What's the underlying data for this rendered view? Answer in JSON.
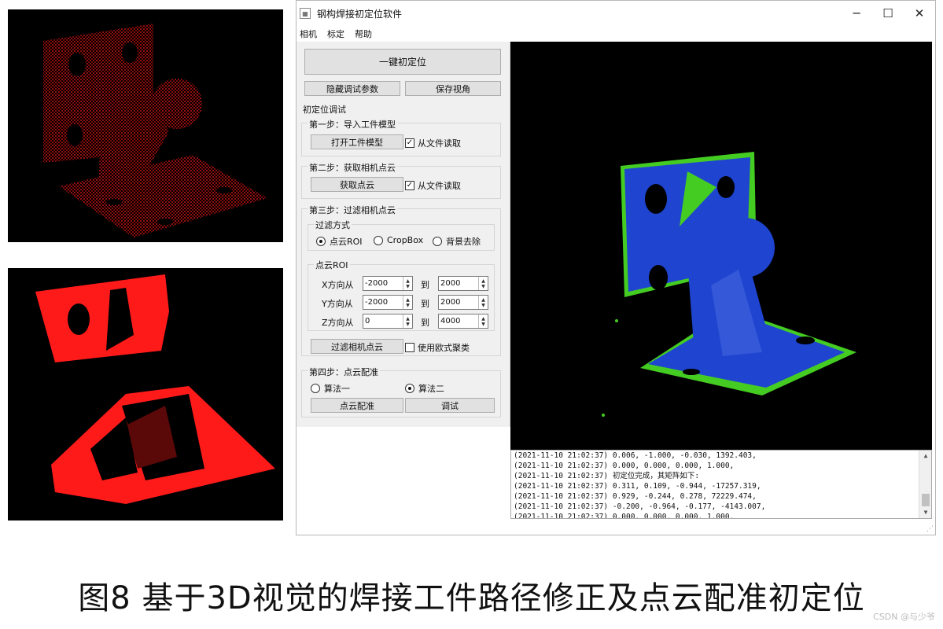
{
  "window": {
    "title": "钢构焊接初定位软件",
    "minimize_glyph": "─",
    "maximize_glyph": "☐",
    "close_glyph": "✕"
  },
  "menu": [
    "相机",
    "标定",
    "帮助"
  ],
  "buttons": {
    "one_click": "一键初定位",
    "hide_params": "隐藏调试参数",
    "save_view": "保存视角"
  },
  "debug_title": "初定位调试",
  "step1": {
    "title": "第一步：导入工件模型",
    "button": "打开工件模型",
    "checkbox": "从文件读取",
    "checked": true
  },
  "step2": {
    "title": "第二步：获取相机点云",
    "button": "获取点云",
    "checkbox": "从文件读取",
    "checked": true
  },
  "step3": {
    "title": "第三步：过滤相机点云",
    "filter_group": "过滤方式",
    "filter_options": [
      "点云ROI",
      "CropBox",
      "背景去除"
    ],
    "filter_selected": "点云ROI",
    "roi_group": "点云ROI",
    "rows": [
      {
        "label": "X方向从",
        "from": "-2000",
        "to_label": "到",
        "to": "2000"
      },
      {
        "label": "Y方向从",
        "from": "-2000",
        "to_label": "到",
        "to": "2000"
      },
      {
        "label": "Z方向从",
        "from": "0",
        "to_label": "到",
        "to": "4000"
      }
    ],
    "button": "过滤相机点云",
    "checkbox": "使用欧式聚类",
    "checked": false
  },
  "step4": {
    "title": "第四步：点云配准",
    "options": [
      "算法一",
      "算法二"
    ],
    "selected": "算法二",
    "register_button": "点云配准",
    "debug_button": "调试"
  },
  "log": [
    "(2021-11-10 21:02:37) 0.006, -1.000, -0.030, 1392.403,",
    "(2021-11-10 21:02:37) 0.000, 0.000, 0.000, 1.000,",
    "(2021-11-10 21:02:37) 初定位完成，其矩阵如下:",
    "(2021-11-10 21:02:37) 0.311, 0.109, -0.944, -17257.319,",
    "(2021-11-10 21:02:37) 0.929, -0.244, 0.278, 72229.474,",
    "(2021-11-10 21:02:37) -0.200, -0.964, -0.177, -4143.007,",
    "(2021-11-10 21:02:37) 0.000, 0.000, 0.000, 1.000,"
  ],
  "caption": "图8   基于3D视觉的焊接工件路径修正及点云配准初定位",
  "watermark": "CSDN @与少爷",
  "colors": {
    "cloud_red": "#ff1a1a",
    "model_blue": "#1e44d0",
    "scene_green": "#44cc22",
    "panel_bg": "#f0f0f0"
  }
}
